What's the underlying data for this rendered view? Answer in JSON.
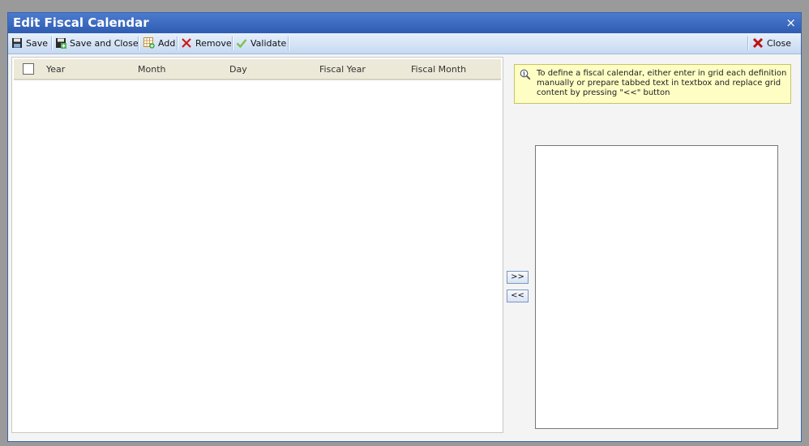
{
  "dialog": {
    "title": "Edit Fiscal Calendar",
    "close_glyph": "×"
  },
  "toolbar": {
    "save": "Save",
    "save_and_close": "Save and Close",
    "add": "Add",
    "remove": "Remove",
    "validate": "Validate",
    "close": "Close"
  },
  "grid": {
    "columns": [
      "Year",
      "Month",
      "Day",
      "Fiscal Year",
      "Fiscal Month"
    ]
  },
  "transfer": {
    "to_text": ">>",
    "to_grid": "<<"
  },
  "info": {
    "text": "To define a fiscal calendar, either enter in grid each definition manually or prepare tabbed text in textbox and replace grid content by pressing \"<<\" button"
  },
  "textbox": {
    "value": ""
  },
  "colors": {
    "title_bar": "#2f5cb0",
    "toolbar": "#c6d9f2",
    "info_bg": "#fdfdc4",
    "header_bg": "#ece9d8"
  }
}
